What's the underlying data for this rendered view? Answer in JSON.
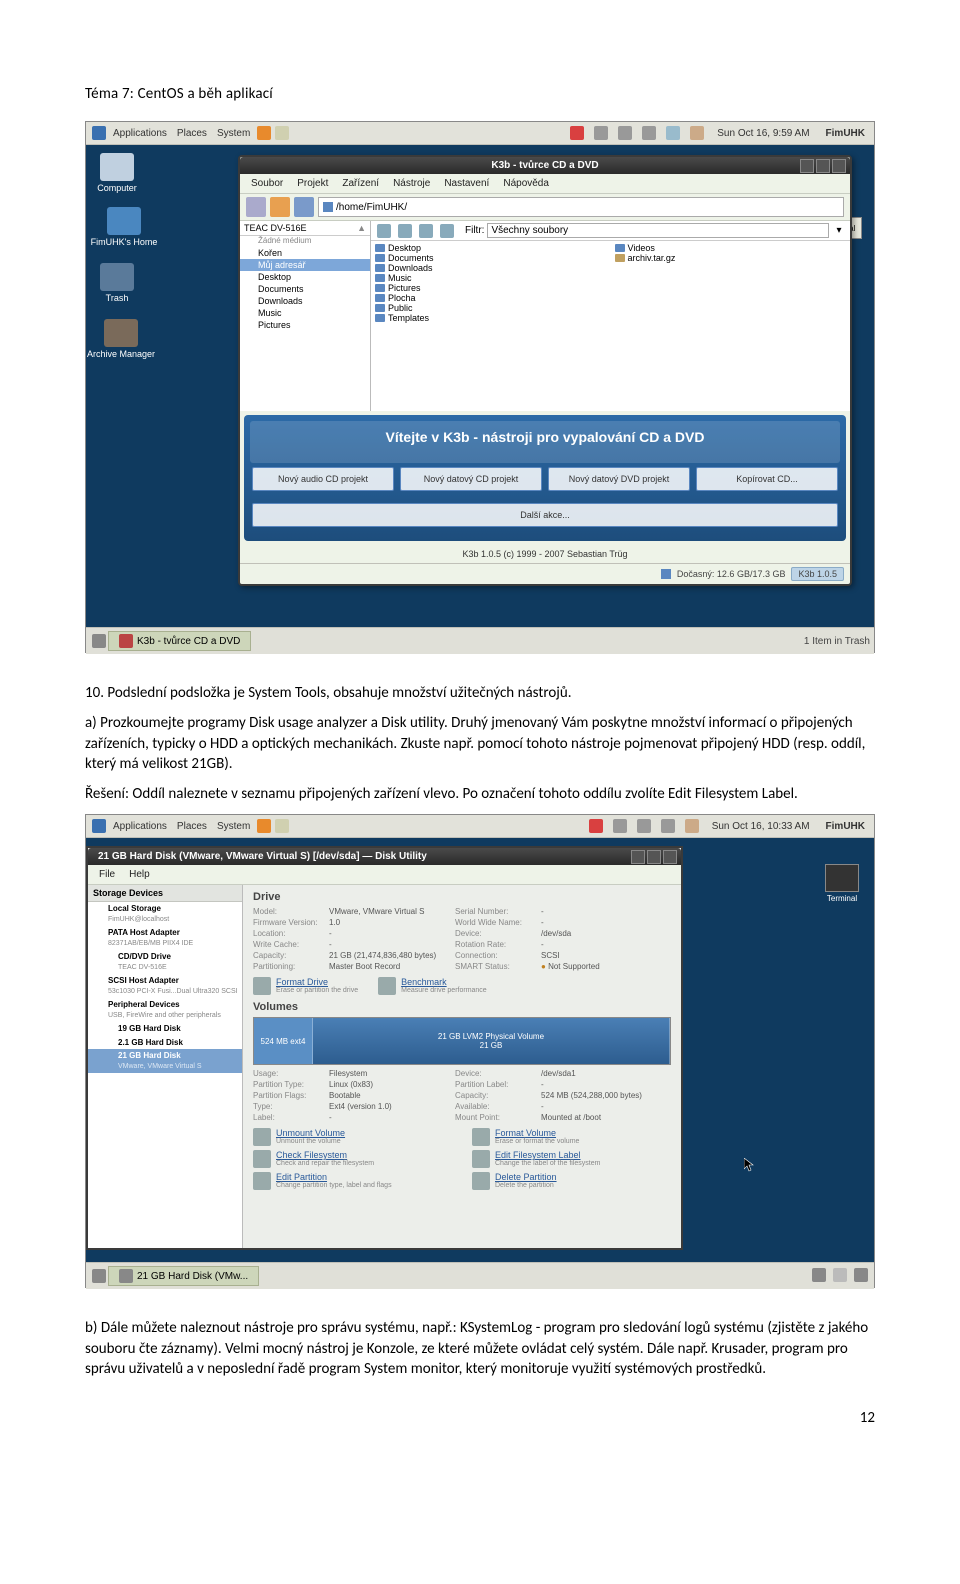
{
  "header": "Téma 7: CentOS a běh aplikací",
  "page_number": "12",
  "text": {
    "p1": "10. Podslední podsložka je System Tools, obsahuje množství užitečných nástrojů.",
    "p2": "a) Prozkoumejte programy Disk usage analyzer a Disk utility. Druhý jmenovaný Vám poskytne množství informací o připojených zařízeních, typicky o HDD a optických mechanikách. Zkuste např. pomocí tohoto nástroje pojmenovat připojený HDD (resp. oddíl, který má velikost 21GB).",
    "p3": "Řešení: Oddíl naleznete v seznamu připojených zařízení vlevo. Po označení tohoto oddílu zvolíte Edit Filesystem Label.",
    "p4": "b) Dále můžete naleznout nástroje pro správu systému, např.: KSystemLog - program pro sledování logů systému (zjistěte z jakého souboru čte záznamy). Velmi mocný nástroj je Konzole, ze které můžete ovládat celý systém. Dále např. Krusader, program pro správu uživatelů a v neposlední řadě program System monitor, který monitoruje využití systémových prostředků."
  },
  "ss1": {
    "panel": {
      "apps": "Applications",
      "places": "Places",
      "system": "System",
      "clock": "Sun Oct 16, 9:59 AM",
      "user": "FimUHK"
    },
    "desktop": {
      "computer": "Computer",
      "home": "FimUHK's Home",
      "trash": "Trash",
      "archive": "Archive Manager"
    },
    "k3b": {
      "title": "K3b - tvůrce CD a DVD",
      "menu": {
        "m1": "Soubor",
        "m2": "Projekt",
        "m3": "Zařízení",
        "m4": "Nástroje",
        "m5": "Nastavení",
        "m6": "Nápověda"
      },
      "path": "/home/FimUHK/",
      "tree_header": "TEAC DV-516E",
      "tree_sub": "Žádné médium",
      "tree": {
        "t1": "Kořen",
        "t2": "Můj adresář",
        "t3": "Desktop",
        "t4": "Documents",
        "t5": "Downloads",
        "t6": "Music",
        "t7": "Pictures"
      },
      "filter_label": "Filtr:",
      "filter_value": "Všechny soubory",
      "files_left": {
        "f1": "Desktop",
        "f2": "Documents",
        "f3": "Downloads",
        "f4": "Music",
        "f5": "Pictures",
        "f6": "Plocha",
        "f7": "Public",
        "f8": "Templates"
      },
      "files_right": {
        "f1": "Videos",
        "f2": "archiv.tar.gz"
      },
      "welcome": "Vítejte v K3b - nástroji pro vypalování CD a DVD",
      "projects": {
        "p1": "Nový audio CD projekt",
        "p2": "Nový datový CD projekt",
        "p3": "Nový datový DVD projekt",
        "p4": "Kopírovat CD..."
      },
      "more": "Další akce...",
      "footer_credit": "K3b 1.0.5 (c) 1999 - 2007 Sebastian Trüg",
      "status_temp": "Dočasný: 12.6 GB/17.3 GB",
      "status_ver": "K3b 1.0.5",
      "nal_txt": "nal"
    },
    "taskbar": {
      "task": "K3b - tvůrce CD a DVD",
      "tray": "1 Item in Trash"
    }
  },
  "ss2": {
    "panel": {
      "apps": "Applications",
      "places": "Places",
      "system": "System",
      "clock": "Sun Oct 16, 10:33 AM",
      "user": "FimUHK"
    },
    "du": {
      "title": "21 GB Hard Disk (VMware, VMware Virtual S) [/dev/sda] — Disk Utility",
      "menu": {
        "m1": "File",
        "m2": "Help"
      },
      "side_hdr": "Storage Devices",
      "side": {
        "s1": "Local Storage",
        "s1s": "FimUHK@localhost",
        "s2": "PATA Host Adapter",
        "s2s": "82371AB/EB/MB PIIX4 IDE",
        "s3": "CD/DVD Drive",
        "s3s": "TEAC DV-516E",
        "s4": "SCSI Host Adapter",
        "s4s": "53c1030 PCI-X Fusi...Dual Ultra320 SCSI",
        "s5": "Peripheral Devices",
        "s5s": "USB, FireWire and other peripherals",
        "s6": "19 GB Hard Disk",
        "s7": "2.1 GB Hard Disk",
        "s8": "21 GB Hard Disk",
        "s8s": "VMware, VMware Virtual S"
      },
      "drive_title": "Drive",
      "drive_grid": {
        "model_l": "Model:",
        "model_v": "VMware, VMware Virtual S",
        "serial_l": "Serial Number:",
        "serial_v": "-",
        "fw_l": "Firmware Version:",
        "fw_v": "1.0",
        "wwn_l": "World Wide Name:",
        "wwn_v": "-",
        "loc_l": "Location:",
        "loc_v": "-",
        "dev_l": "Device:",
        "dev_v": "/dev/sda",
        "wc_l": "Write Cache:",
        "wc_v": "-",
        "rot_l": "Rotation Rate:",
        "rot_v": "-",
        "cap_l": "Capacity:",
        "cap_v": "21 GB (21,474,836,480 bytes)",
        "conn_l": "Connection:",
        "conn_v": "SCSI",
        "part_l": "Partitioning:",
        "part_v": "Master Boot Record",
        "smart_l": "SMART Status:",
        "smart_v": "Not Supported"
      },
      "act1": {
        "t": "Format Drive",
        "s": "Erase or partition the drive"
      },
      "act2": {
        "t": "Benchmark",
        "s": "Measure drive performance"
      },
      "vol_title": "Volumes",
      "vol1": {
        "t": "524 MB ext4",
        "s": ""
      },
      "vol2": {
        "t": "21 GB LVM2 Physical Volume",
        "s": "21 GB"
      },
      "usage_grid": {
        "usage_l": "Usage:",
        "usage_v": "Filesystem",
        "dev2_l": "Device:",
        "dev2_v": "/dev/sda1",
        "pt_l": "Partition Type:",
        "pt_v": "Linux (0x83)",
        "pl_l": "Partition Label:",
        "pl_v": "-",
        "pf_l": "Partition Flags:",
        "pf_v": "Bootable",
        "cap2_l": "Capacity:",
        "cap2_v": "524 MB (524,288,000 bytes)",
        "type_l": "Type:",
        "type_v": "Ext4 (version 1.0)",
        "avail_l": "Available:",
        "avail_v": "-",
        "label_l": "Label:",
        "label_v": "-",
        "mp_l": "Mount Point:",
        "mp_v": "Mounted at /boot"
      },
      "pact1": {
        "t": "Unmount Volume",
        "s": "Unmount the volume"
      },
      "pact2": {
        "t": "Format Volume",
        "s": "Erase or format the volume"
      },
      "pact3": {
        "t": "Check Filesystem",
        "s": "Check and repair the filesystem"
      },
      "pact4": {
        "t": "Edit Filesystem Label",
        "s": "Change the label of the filesystem"
      },
      "pact5": {
        "t": "Edit Partition",
        "s": "Change partition type, label and flags"
      },
      "pact6": {
        "t": "Delete Partition",
        "s": "Delete the partition"
      }
    },
    "terminal": "Terminal",
    "taskbar": "21 GB Hard Disk (VMw..."
  }
}
